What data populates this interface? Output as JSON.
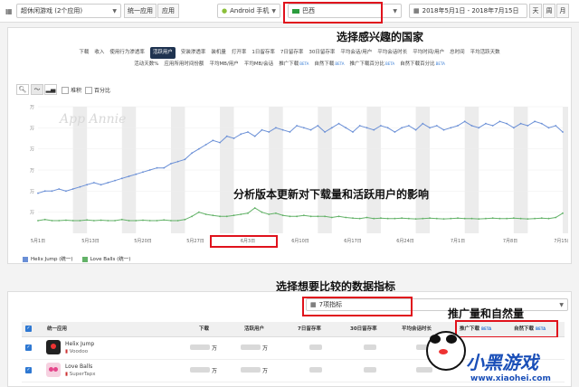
{
  "header": {
    "app_select": "超休闲游戏 (2个应用)",
    "unified_app_btn": "统一应用",
    "app_btn": "应用",
    "device_select": "Android 手机",
    "country_select": "巴西",
    "date_range": "2018年5月1日 - 2018年7月15日",
    "granularity": [
      "天",
      "周",
      "月"
    ]
  },
  "annotations": {
    "country": "选择感兴趣的国家",
    "analysis": "分析版本更新对下载量和活跃用户的影响",
    "metrics": "选择想要比较的数据指标",
    "promo": "推广量和自然量"
  },
  "tabs_row1": [
    "下载",
    "收入",
    "使用行为渗透率",
    "活跃用户",
    "安装渗透率",
    "装机量",
    "打开率",
    "1日留存率",
    "7日留存率",
    "30日留存率",
    "平均会话/用户",
    "平均会话时长",
    "平均时间/用户",
    "总时间",
    "平均活跃天数"
  ],
  "tabs_row2": [
    {
      "label": "活动天数%",
      "beta": ""
    },
    {
      "label": "应用所用时间份额",
      "beta": ""
    },
    {
      "label": "平均MB/用户",
      "beta": ""
    },
    {
      "label": "平均MB/会话",
      "beta": ""
    },
    {
      "label": "推广下载",
      "beta": "BETA"
    },
    {
      "label": "自然下载",
      "beta": "BETA"
    },
    {
      "label": "推广下载百分比",
      "beta": "BETA"
    },
    {
      "label": "自然下载百分比",
      "beta": "BETA"
    }
  ],
  "active_tab": "活跃用户",
  "toolbar": {
    "stack_label": "堆积",
    "percent_label": "百分比"
  },
  "watermark": "App Annie",
  "chart_data": {
    "type": "line",
    "x_ticks": [
      "5月1日",
      "5月13日",
      "5月20日",
      "5月27日",
      "6月3日",
      "6月10日",
      "6月17日",
      "6月24日",
      "7月1日",
      "7月8日",
      "7月15日"
    ],
    "y_ticks": [
      "万",
      "万",
      "万",
      "万",
      "万",
      "万"
    ],
    "ylim": [
      0,
      6
    ],
    "series": [
      {
        "name": "Helix Jump (统一)",
        "color": "#6a8fd6",
        "values": [
          1.9,
          2.0,
          2.0,
          2.1,
          2.0,
          2.1,
          2.2,
          2.3,
          2.4,
          2.3,
          2.4,
          2.5,
          2.6,
          2.7,
          2.8,
          2.9,
          3.0,
          3.1,
          3.1,
          3.3,
          3.4,
          3.5,
          3.8,
          4.0,
          4.2,
          4.4,
          4.3,
          4.6,
          4.5,
          4.7,
          4.8,
          4.6,
          4.9,
          4.8,
          5.0,
          4.9,
          4.8,
          5.1,
          5.0,
          4.9,
          5.1,
          4.8,
          5.0,
          5.2,
          5.0,
          4.8,
          5.1,
          5.0,
          4.9,
          5.1,
          5.0,
          4.8,
          5.0,
          5.1,
          4.9,
          5.2,
          5.0,
          5.1,
          4.9,
          5.0,
          5.1,
          5.3,
          5.1,
          5.0,
          5.2,
          5.1,
          5.3,
          5.2,
          5.0,
          5.2,
          5.1,
          5.3,
          5.2,
          5.0,
          5.1,
          4.8
        ]
      },
      {
        "name": "Love Balls (统一)",
        "color": "#63b268",
        "values": [
          0.6,
          0.65,
          0.6,
          0.6,
          0.62,
          0.6,
          0.6,
          0.63,
          0.6,
          0.62,
          0.6,
          0.6,
          0.65,
          0.6,
          0.6,
          0.62,
          0.6,
          0.6,
          0.63,
          0.6,
          0.6,
          0.65,
          0.8,
          1.0,
          0.9,
          0.85,
          0.8,
          0.8,
          0.85,
          0.9,
          0.95,
          1.2,
          1.0,
          0.9,
          0.95,
          0.85,
          0.8,
          0.8,
          0.85,
          0.8,
          0.8,
          0.8,
          0.75,
          0.8,
          0.75,
          0.72,
          0.7,
          0.75,
          0.7,
          0.72,
          0.7,
          0.7,
          0.72,
          0.7,
          0.68,
          0.7,
          0.72,
          0.7,
          0.68,
          0.7,
          0.72,
          0.7,
          0.7,
          0.68,
          0.7,
          0.72,
          0.7,
          0.7,
          0.72,
          0.7,
          0.68,
          0.7,
          0.72,
          0.7,
          0.75,
          0.95
        ]
      }
    ]
  },
  "metrics_select": "7项指标",
  "table": {
    "headers": [
      "统一应用",
      "下载",
      "活跃用户",
      "7日留存率",
      "30日留存率",
      "平均会话时长",
      "推广下载",
      "自然下载"
    ],
    "beta": "BETA",
    "rows": [
      {
        "name": "Helix Jump",
        "publisher": "Voodoo",
        "downloads_unit": "万",
        "users_unit": "万"
      },
      {
        "name": "Love Balls",
        "publisher": "SuperTapx",
        "downloads_unit": "万",
        "users_unit": "万"
      }
    ]
  },
  "brand": {
    "logo_text": "小黑游戏",
    "url": "www.xiaohei.com"
  }
}
